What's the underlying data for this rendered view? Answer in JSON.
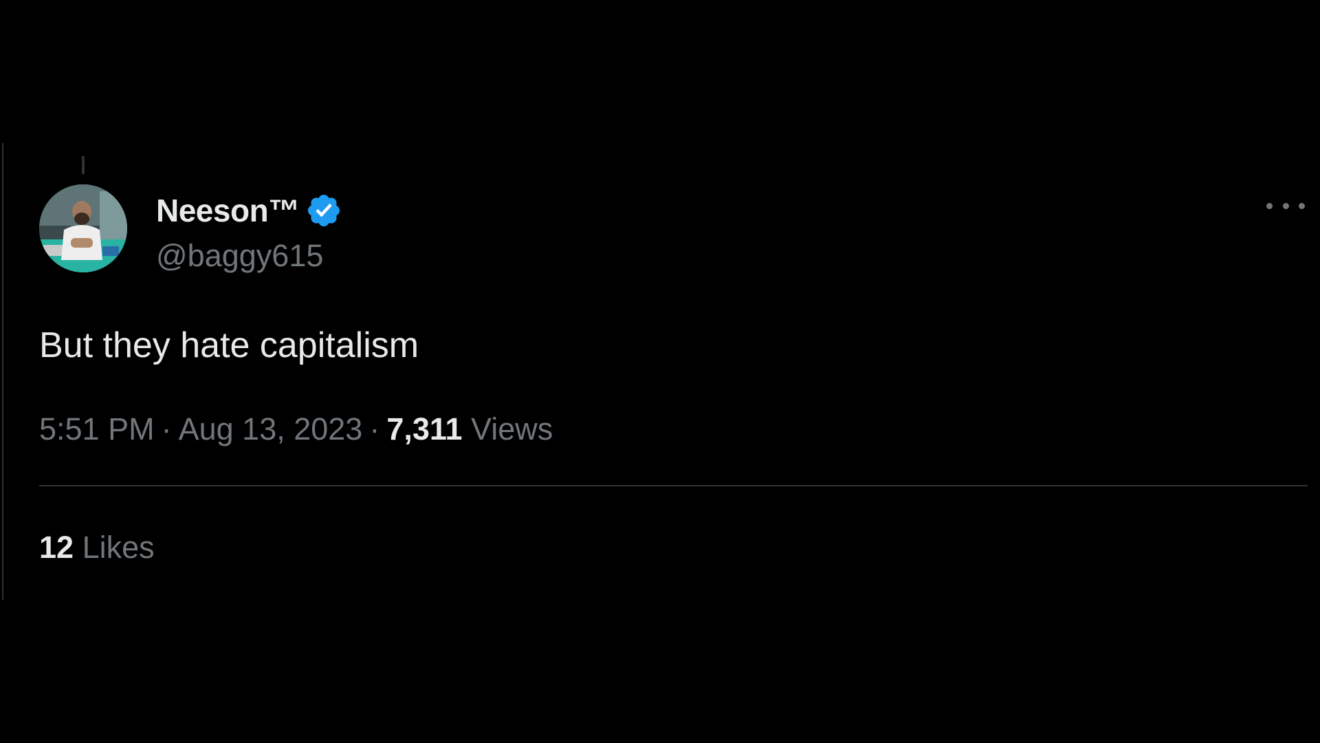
{
  "tweet": {
    "display_name": "Neeson™",
    "handle": "@baggy615",
    "text": "But they hate capitalism",
    "time": "5:51 PM",
    "date": "Aug 13, 2023",
    "separator": "·",
    "views_count": "7,311",
    "views_label": "Views",
    "likes_count": "12",
    "likes_label": "Likes"
  },
  "icons": {
    "verified": "verified-badge-icon",
    "more": "more-options-icon"
  },
  "colors": {
    "background": "#000000",
    "primary_text": "#e7e9ea",
    "secondary_text": "#71767b",
    "divider": "#2f3336",
    "verified_blue": "#1d9bf0"
  }
}
